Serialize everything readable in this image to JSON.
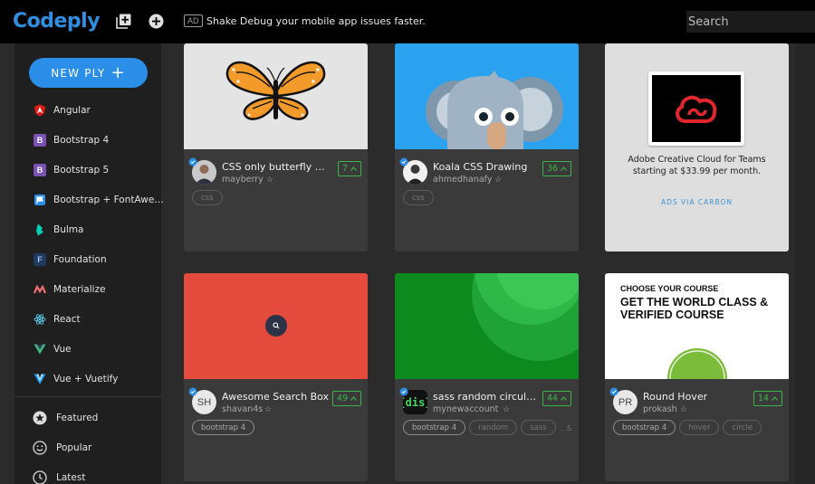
{
  "brand": {
    "logo": "Codeply",
    "accent": "#2f8fe0"
  },
  "topbar": {
    "ad_tag": "AD",
    "ad_text": "Shake Debug your mobile app issues faster.",
    "search_placeholder": "Search",
    "icons": [
      "add-box-icon",
      "plus-circle-icon"
    ]
  },
  "sidebar": {
    "new_button": "NEW PLY",
    "frameworks": [
      {
        "label": "Angular",
        "icon": "angular-icon"
      },
      {
        "label": "Bootstrap 4",
        "icon": "bootstrap-icon"
      },
      {
        "label": "Bootstrap 5",
        "icon": "bootstrap-icon"
      },
      {
        "label": "Bootstrap + FontAwe…",
        "icon": "fontawesome-icon"
      },
      {
        "label": "Bulma",
        "icon": "bulma-icon"
      },
      {
        "label": "Foundation",
        "icon": "foundation-icon"
      },
      {
        "label": "Materialize",
        "icon": "materialize-icon"
      },
      {
        "label": "React",
        "icon": "react-icon"
      },
      {
        "label": "Vue",
        "icon": "vue-icon"
      },
      {
        "label": "Vue + Vuetify",
        "icon": "vuetify-icon"
      }
    ],
    "sections": [
      {
        "label": "Featured",
        "icon": "star-icon"
      },
      {
        "label": "Popular",
        "icon": "smiley-icon"
      },
      {
        "label": "Latest",
        "icon": "clock-icon"
      }
    ]
  },
  "cards": [
    {
      "title": "CSS only butterfly wi…",
      "user": "mayberry",
      "likes": "7",
      "tags": [
        "css"
      ]
    },
    {
      "title": "Koala CSS Drawing",
      "user": "ahmedhanafy",
      "likes": "36",
      "tags": [
        "css"
      ]
    },
    {
      "title": "Awesome Search Box",
      "user": "shavan4s",
      "likes": "49",
      "avatar_initials": "SH",
      "tags": [
        "bootstrap 4"
      ]
    },
    {
      "title": "sass random circula…",
      "user": "mynewaccount",
      "likes": "44",
      "avatar_text": "{dis}",
      "tags": [
        "bootstrap 4",
        "random",
        "sass"
      ],
      "more": "…5"
    },
    {
      "title": "Round Hover",
      "user": "prokash",
      "likes": "14",
      "avatar_initials": "PR",
      "tags": [
        "bootstrap 4",
        "hover",
        "circle"
      ],
      "preview_eyebrow": "CHOOSE YOUR COURSE",
      "preview_title": "GET THE WORLD CLASS & VERIFIED COURSE"
    }
  ],
  "ad_card": {
    "copy": "Adobe Creative Cloud for Teams starting at $33.99 per month.",
    "via": "ADS VIA CARBON"
  },
  "colors": {
    "like_green": "#3bb54a",
    "verified_blue": "#2b8ee8"
  }
}
